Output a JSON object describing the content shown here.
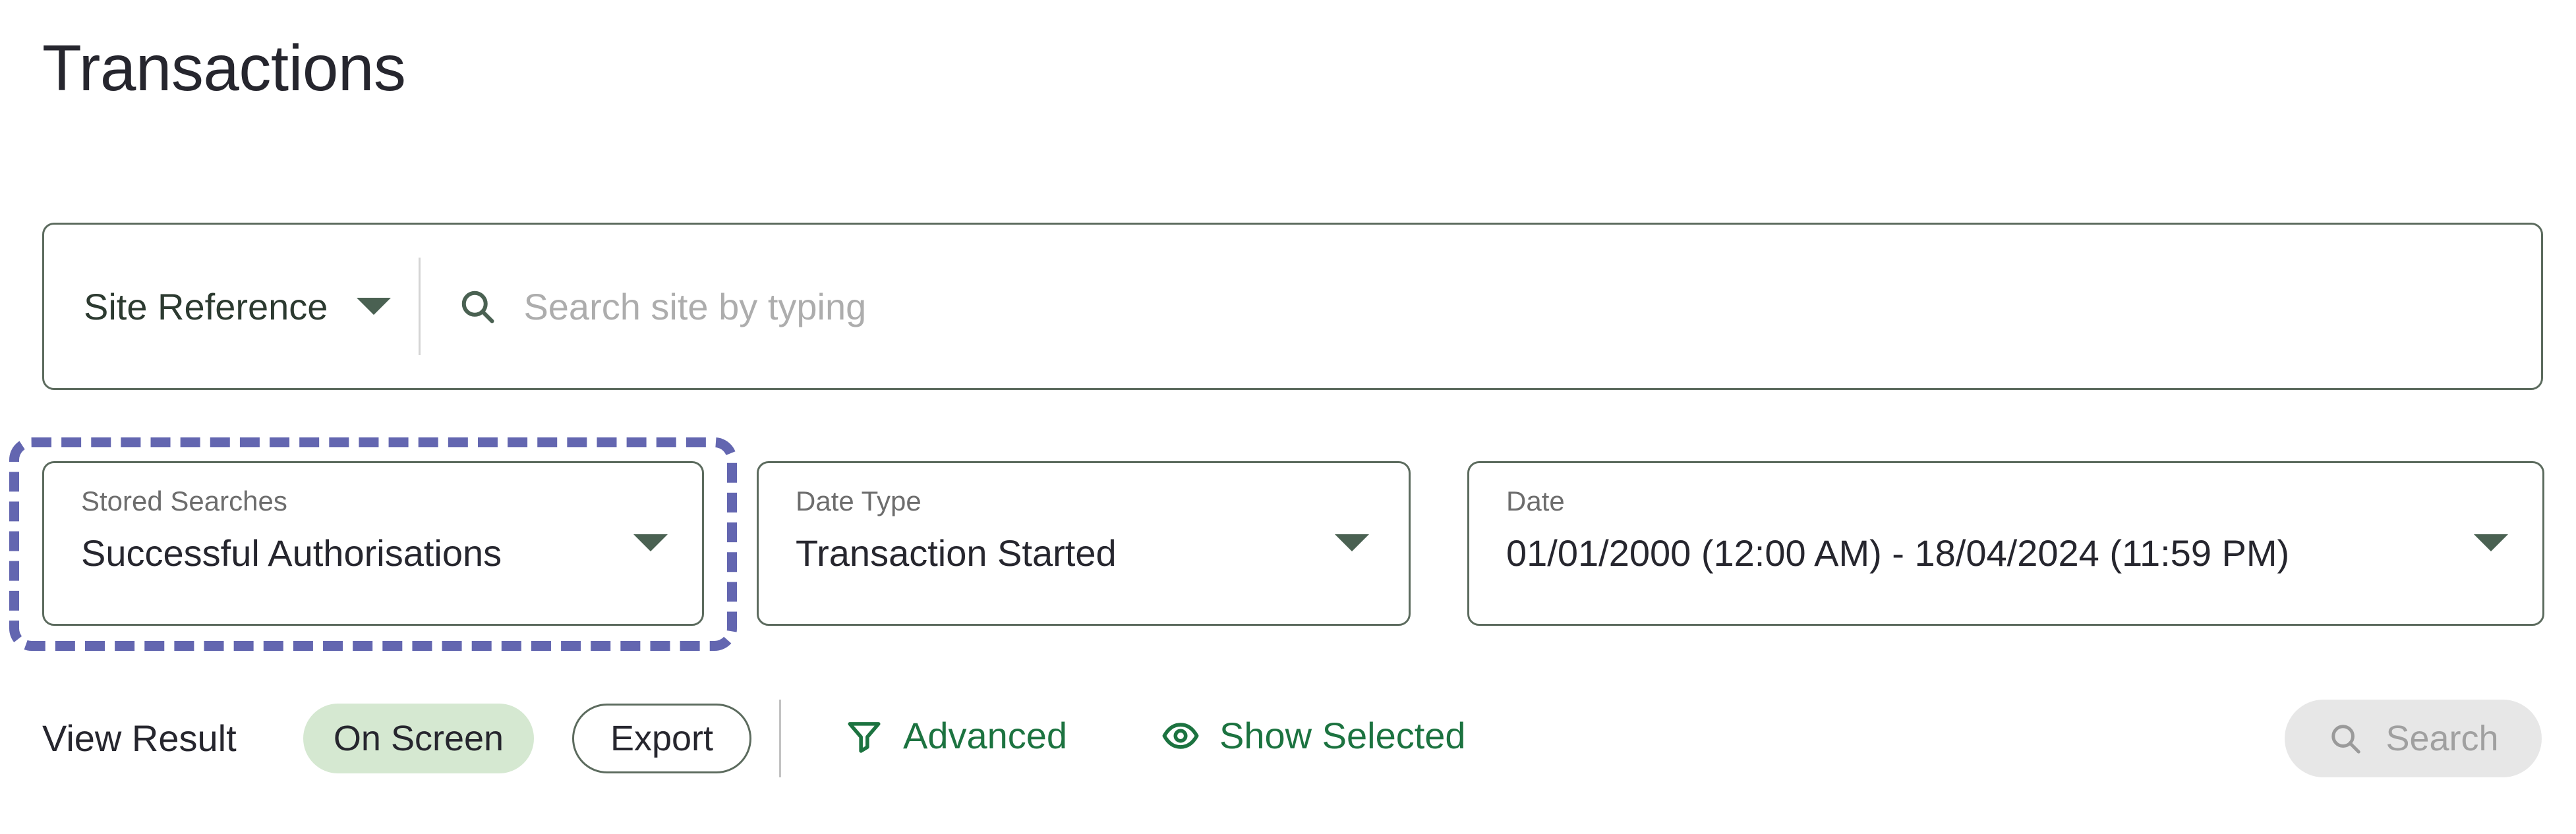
{
  "page": {
    "title": "Transactions"
  },
  "site_search": {
    "type_label": "Site Reference",
    "type_caret_icon": "chevron-down-icon",
    "search_icon": "search-icon",
    "input_value": "",
    "placeholder": "Search site by typing"
  },
  "fields": [
    {
      "label": "Stored Searches",
      "value": "Successful Authorisations",
      "caret_icon": "chevron-down-icon",
      "highlighted": true
    },
    {
      "label": "Date Type",
      "value": "Transaction Started",
      "caret_icon": "chevron-down-icon",
      "highlighted": false
    },
    {
      "label": "Date",
      "value": "01/01/2000 (12:00 AM) - 18/04/2024 (11:59 PM)",
      "caret_icon": "chevron-down-icon",
      "highlighted": false
    }
  ],
  "toolbar": {
    "view_result_label": "View Result",
    "on_screen_label": "On Screen",
    "export_label": "Export",
    "advanced_label": "Advanced",
    "advanced_icon": "filter-funnel-icon",
    "show_selected_label": "Show Selected",
    "show_selected_icon": "eye-icon",
    "search_label": "Search",
    "search_icon": "search-icon"
  },
  "colors": {
    "accent_green": "#1c7340",
    "border_green": "#5c6b5e",
    "highlight_purple": "#6366b0",
    "pill_green_bg": "#d5e8d1",
    "disabled_gray_bg": "#e7e7e7",
    "text_dark": "#26262e",
    "text_muted": "#6d6d6d",
    "placeholder_gray": "#adadad"
  }
}
